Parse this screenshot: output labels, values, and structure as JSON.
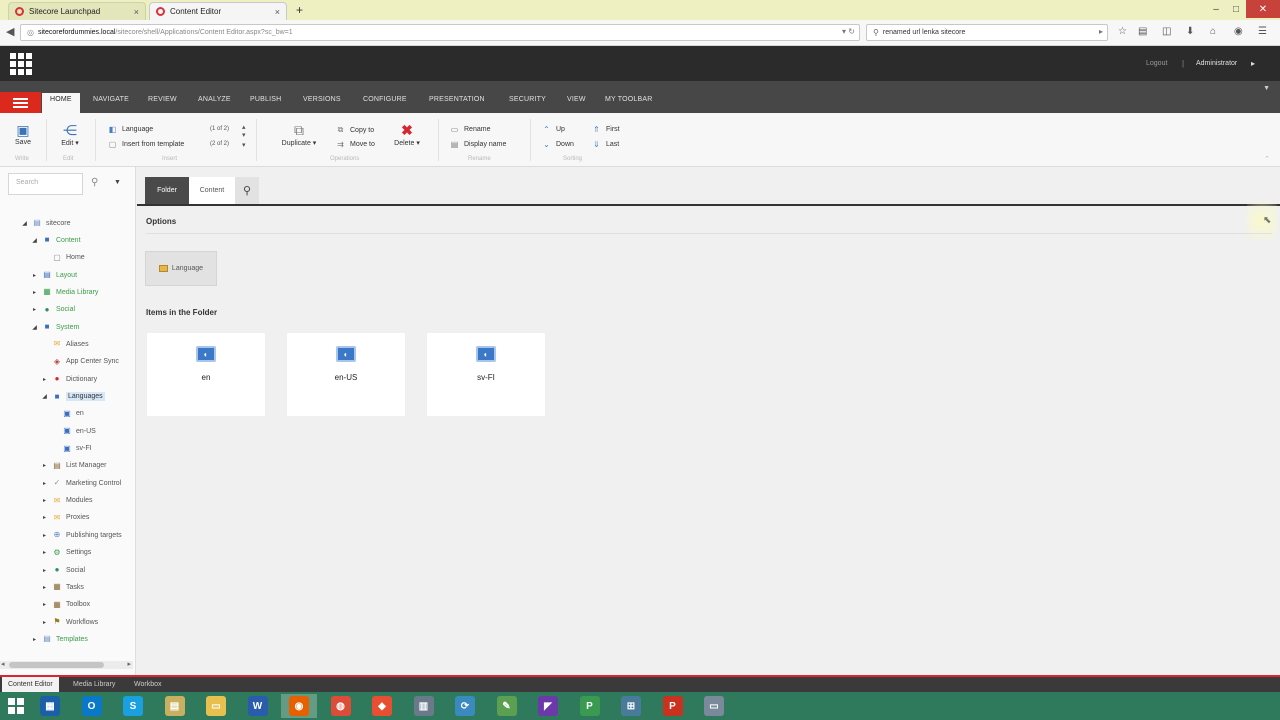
{
  "browser": {
    "tabs": [
      {
        "label": "Sitecore Launchpad",
        "close": "×"
      },
      {
        "label": "Content Editor",
        "close": "×"
      }
    ],
    "new_tab": "+",
    "window_controls": {
      "minimize": "–",
      "maximize": "□",
      "close": "✕"
    },
    "url_host": "sitecorefordummies.local",
    "url_path": "/sitecore/shell/Applications/Content Editor.aspx?sc_bw=1",
    "search_value": "renamed url lenka sitecore"
  },
  "header": {
    "logout": "Logout",
    "separator": "|",
    "user": "Administrator"
  },
  "ribbon_tabs": [
    "HOME",
    "NAVIGATE",
    "REVIEW",
    "ANALYZE",
    "PUBLISH",
    "VERSIONS",
    "CONFIGURE",
    "PRESENTATION",
    "SECURITY",
    "VIEW",
    "MY TOOLBAR"
  ],
  "ribbon": {
    "save": "Save",
    "edit": "Edit",
    "insert_language": "Language",
    "insert_language_count": "(1 of 2)",
    "insert_from_template": "Insert from template",
    "insert_template_count": "(2 of 2)",
    "duplicate": "Duplicate",
    "copy_to": "Copy to",
    "move_to": "Move to",
    "delete": "Delete",
    "rename": "Rename",
    "display_name": "Display name",
    "up": "Up",
    "down": "Down",
    "first": "First",
    "last": "Last",
    "groups": [
      "Write",
      "Edit",
      "Insert",
      "Operations",
      "Rename",
      "Sorting"
    ]
  },
  "search": {
    "placeholder": "Search"
  },
  "tree": [
    {
      "label": "sitecore",
      "toggle": "◢",
      "color": "gray"
    },
    {
      "label": "Content",
      "toggle": "◢",
      "color": "green"
    },
    {
      "label": "Home",
      "toggle": "",
      "color": "gray"
    },
    {
      "label": "Layout",
      "toggle": "▸",
      "color": "green"
    },
    {
      "label": "Media Library",
      "toggle": "▸",
      "color": "green"
    },
    {
      "label": "Social",
      "toggle": "▸",
      "color": "green"
    },
    {
      "label": "System",
      "toggle": "◢",
      "color": "green"
    },
    {
      "label": "Aliases",
      "toggle": "",
      "color": "gray"
    },
    {
      "label": "App Center Sync",
      "toggle": "",
      "color": "gray"
    },
    {
      "label": "Dictionary",
      "toggle": "▸",
      "color": "gray"
    },
    {
      "label": "Languages",
      "toggle": "◢",
      "color": "gray"
    },
    {
      "label": "en",
      "toggle": "",
      "color": "gray"
    },
    {
      "label": "en-US",
      "toggle": "",
      "color": "gray"
    },
    {
      "label": "sv-FI",
      "toggle": "",
      "color": "gray"
    },
    {
      "label": "List Manager",
      "toggle": "▸",
      "color": "gray"
    },
    {
      "label": "Marketing Control",
      "toggle": "▸",
      "color": "gray"
    },
    {
      "label": "Modules",
      "toggle": "▸",
      "color": "gray"
    },
    {
      "label": "Proxies",
      "toggle": "▸",
      "color": "gray"
    },
    {
      "label": "Publishing targets",
      "toggle": "▸",
      "color": "gray"
    },
    {
      "label": "Settings",
      "toggle": "▸",
      "color": "gray"
    },
    {
      "label": "Social",
      "toggle": "▸",
      "color": "gray"
    },
    {
      "label": "Tasks",
      "toggle": "▸",
      "color": "gray"
    },
    {
      "label": "Toolbox",
      "toggle": "▸",
      "color": "gray"
    },
    {
      "label": "Workflows",
      "toggle": "▸",
      "color": "gray"
    },
    {
      "label": "Templates",
      "toggle": "▸",
      "color": "green"
    }
  ],
  "editor_tabs": {
    "folder": "Folder",
    "content": "Content"
  },
  "options_heading": "Options",
  "language_button": "Language",
  "items_heading": "Items in the Folder",
  "items": [
    {
      "label": "en"
    },
    {
      "label": "en-US"
    },
    {
      "label": "sv-FI"
    }
  ],
  "bottom_tabs": [
    "Content Editor",
    "Media Library",
    "Workbox"
  ],
  "colors": {
    "accent_red": "#dc291e",
    "tree_green": "#3a9d4a",
    "ribbon_dark": "#474747"
  },
  "taskbar_apps": [
    "windows-explorer",
    "outlook",
    "skype",
    "file-manager",
    "folder",
    "word",
    "firefox",
    "chrome",
    "git",
    "calculator",
    "sync",
    "paint",
    "visual-studio",
    "project",
    "network",
    "powerpoint",
    "window"
  ]
}
